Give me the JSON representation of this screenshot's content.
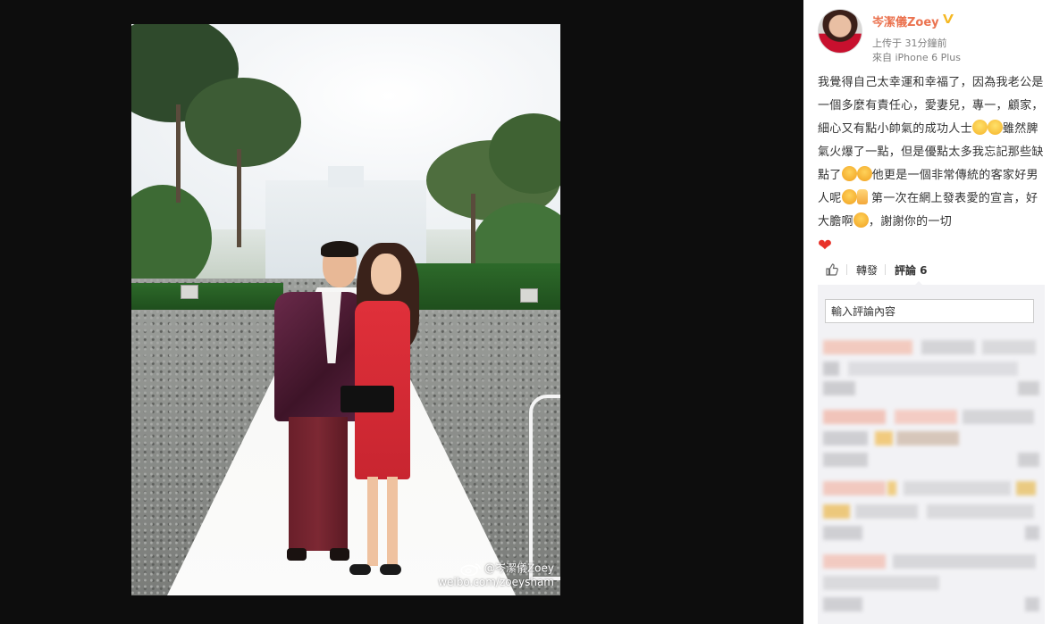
{
  "post": {
    "username": "岑潔儀Zoey",
    "posted_time": "上传于 31分鐘前",
    "source": "來自 iPhone 6 Plus",
    "text_segments": [
      "我覺得自己太幸運和幸福了，因為我老公是一個多麼有責任心，愛妻兒，專一，顧家，細心又有點小帥氣的成功人士",
      "雖然脾氣火爆了一點，但是優點太多我忘記那些缺點了",
      "他更是一個非常傳統的客家好男人呢",
      "第一次在網上發表愛的宣言，好大膽啊",
      "，謝謝你的一切"
    ]
  },
  "image": {
    "watermark_handle": "@岑潔儀Zoey",
    "watermark_url": "weibo.com/zoeysham"
  },
  "actions": {
    "repost_label": "轉發",
    "comment_label": "評論 6"
  },
  "comments": {
    "input_placeholder": "輸入評論內容"
  },
  "colors": {
    "username": "#eb7350",
    "background": "#0d0d0d",
    "panel": "#ffffff",
    "comment_area": "#f2f2f5"
  }
}
